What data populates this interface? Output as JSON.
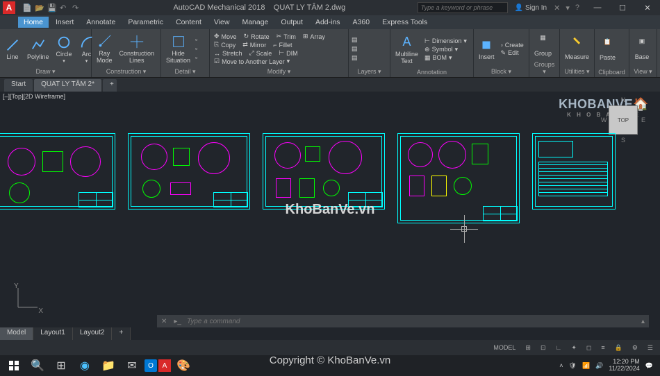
{
  "titlebar": {
    "app_letter": "A",
    "app_name": "AutoCAD Mechanical 2018",
    "doc_name": "QUAT LY TÂM 2.dwg",
    "search_placeholder": "Type a keyword or phrase",
    "signin": "Sign In"
  },
  "menubar": {
    "items": [
      "Home",
      "Insert",
      "Annotate",
      "Parametric",
      "Content",
      "View",
      "Manage",
      "Output",
      "Add-ins",
      "A360",
      "Express Tools"
    ],
    "active": 0
  },
  "ribbon": {
    "draw": {
      "label": "Draw ▾",
      "line": "Line",
      "polyline": "Polyline",
      "circle": "Circle",
      "arc": "Arc"
    },
    "construction": {
      "label": "Construction ▾",
      "ray": "Ray\nMode",
      "clines": "Construction\nLines"
    },
    "detail": {
      "label": "Detail ▾",
      "hide": "Hide\nSituation"
    },
    "modify": {
      "label": "Modify ▾",
      "items": [
        "Move",
        "Rotate",
        "Trim",
        "Array",
        "Copy",
        "Mirror",
        "Fillet",
        "Stretch",
        "Scale",
        "DIM",
        "Move to Another Layer"
      ]
    },
    "layers": {
      "label": "Layers ▾"
    },
    "annotation": {
      "label": "Annotation",
      "multiline": "Multiline\nText",
      "items": [
        "Dimension",
        "Symbol",
        "BOM"
      ]
    },
    "block": {
      "label": "Block ▾",
      "insert": "Insert",
      "create": "Create",
      "edit": "Edit"
    },
    "groups": {
      "label": "Groups ▾",
      "group": "Group"
    },
    "utilities": {
      "label": "Utilities ▾",
      "measure": "Measure"
    },
    "clipboard": {
      "label": "Clipboard",
      "paste": "Paste"
    },
    "view": {
      "label": "View ▾",
      "base": "Base"
    }
  },
  "filetabs": {
    "start": "Start",
    "active": "QUAT LY TÂM 2*"
  },
  "viewport": {
    "label": "[–][Top][2D Wireframe]",
    "cube": "TOP"
  },
  "watermark_logo": {
    "main": "KHOBANVE",
    "sub": "K H O B A N V E"
  },
  "watermark_center": "KhoBanVe.vn",
  "watermark_copy": "Copyright © KhoBanVe.vn",
  "ucs": {
    "x": "X",
    "y": "Y"
  },
  "cmdline": {
    "placeholder": "Type a command"
  },
  "layout_tabs": {
    "model": "Model",
    "l1": "Layout1",
    "l2": "Layout2",
    "plus": "+"
  },
  "statusbar": {
    "model": "MODEL"
  },
  "tray": {
    "time": "12:20 PM",
    "date": "11/22/2024"
  }
}
